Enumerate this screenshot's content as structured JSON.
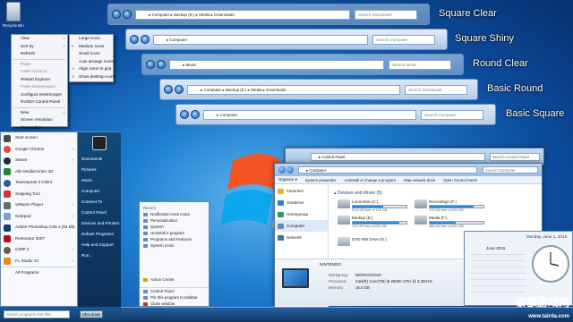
{
  "desktop": {
    "recycle_bin": "Recycle Bin"
  },
  "style_labels": [
    "Square Clear",
    "Square Shiny",
    "Round Clear",
    "Basic Round",
    "Basic Square"
  ],
  "bars": [
    {
      "path": "▸ Computer ▸ Backup (E:) ▸ Media ▸ Downloads",
      "search": "Search Downloads"
    },
    {
      "path": "▸ Computer",
      "search": "Search Computer"
    },
    {
      "path": "▸ Music",
      "search": "Search Music"
    },
    {
      "path": "▸ Computer ▸ Backup (E:) ▸ Media ▸ Downloads",
      "search": "Search Downloads"
    },
    {
      "path": "▸ Computer",
      "search": "Search Computer"
    }
  ],
  "context_menu": {
    "items": [
      "View",
      "Sort by",
      "Refresh",
      "Paste",
      "Paste shortcut",
      "Restart Explorer",
      "Paste DeskScapes",
      "Configure DeskScaper",
      "NVIDIA Control Panel",
      "New",
      "Screen resolution",
      "Personalize"
    ],
    "view_submenu": [
      "Large icons",
      "Medium icons",
      "Small icons",
      "Auto arrange icons",
      "Align icons to grid",
      "Show desktop icons"
    ]
  },
  "start_menu": {
    "left": [
      "Start screen",
      "Google Chrome",
      "Steam",
      "Alle MediaCenter 3D",
      "TeamSpeak 3 Client",
      "Snipping Tool",
      "VMware Player",
      "Notepad",
      "Adobe Photoshop CS5.1 (64 Bit)",
      "Restorator 2007",
      "GIMP 2",
      "FL Studio 10",
      "All Programs"
    ],
    "right": [
      "Documents",
      "Pictures",
      "Music",
      "Computer",
      "Connect To",
      "Control Panel",
      "Devices and Printers",
      "Default Programs",
      "Help and Support",
      "Run..."
    ],
    "search_placeholder": "Search programs and files",
    "shutdown": "Shut down"
  },
  "jump_list": {
    "header": "Recent",
    "items": [
      "Notification Area Icons",
      "Personalization",
      "System",
      "Uninstall a program",
      "Programs and Features",
      "System Icons"
    ],
    "footer": [
      "Action Center",
      "Control Panel",
      "Pin this program to taskbar",
      "Close window"
    ]
  },
  "control_panel_window": {
    "address": "▸ Control Panel",
    "search": "Search Control Panel"
  },
  "explorer": {
    "address": "▸ Computer",
    "search": "Search Computer",
    "toolbar": [
      "Organize ▾",
      "System properties",
      "Uninstall or change a program",
      "Map network drive",
      "Open Control Panel"
    ],
    "side": [
      "Favorites",
      "OneDrive",
      "Homegroup",
      "Computer",
      "Network"
    ],
    "section": "▴ Devices and drives (5)",
    "drives": [
      {
        "name": "Local Disk (C:)",
        "free": "51.6 GB free of 118 GB",
        "used": 0.56
      },
      {
        "name": "Recordings (F:)",
        "free": "179 GB free of 931 GB",
        "used": 0.81
      },
      {
        "name": "Backup (E:)",
        "free": "123 GB free of 931 GB",
        "used": 0.87
      },
      {
        "name": "Media (F:)",
        "free": "485 GB free of 931 GB",
        "used": 0.48
      },
      {
        "name": "DVD RW Drive (G:)",
        "free": "",
        "used": 0
      }
    ],
    "details": {
      "name": "NINTENDO",
      "workgroup_label": "Workgroup:",
      "workgroup": "WORKGROUP",
      "processor_label": "Processor:",
      "processor": "Intel(R) Core(TM) i5-2500K CPU @ 3.30GHz",
      "memory_label": "Memory:",
      "memory": "16.0 GB"
    }
  },
  "calendar": {
    "date": "Monday, June 1, 2015",
    "month": "June 2015",
    "days": [
      "Su",
      "Mo",
      "Tu",
      "We",
      "Th",
      "Fr",
      "Sa"
    ]
  },
  "watermark": {
    "cn": "泰额游戏网",
    "url": "www.tairda.com"
  }
}
